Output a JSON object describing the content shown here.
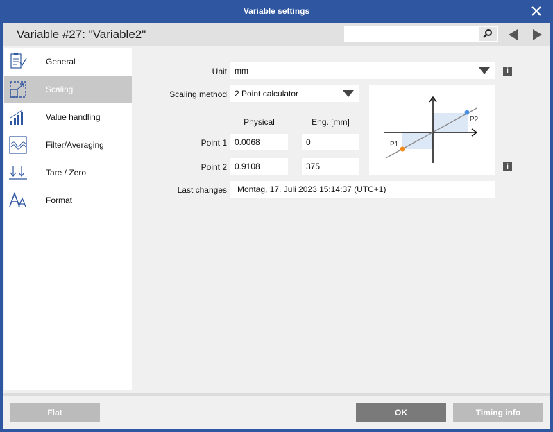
{
  "window": {
    "title": "Variable settings"
  },
  "header": {
    "variable_title": "Variable #27: \"Variable2\"",
    "search_value": ""
  },
  "sidebar": {
    "items": [
      {
        "label": "General",
        "icon": "clipboard-check-icon"
      },
      {
        "label": "Scaling",
        "icon": "scaling-icon",
        "active": true
      },
      {
        "label": "Value handling",
        "icon": "bar-chart-icon"
      },
      {
        "label": "Filter/Averaging",
        "icon": "waveform-icon"
      },
      {
        "label": "Tare / Zero",
        "icon": "tare-arrows-icon"
      },
      {
        "label": "Format",
        "icon": "font-format-icon"
      }
    ]
  },
  "scaling": {
    "unit_label": "Unit",
    "unit_value": "mm",
    "method_label": "Scaling method",
    "method_value": "2 Point calculator",
    "col_physical": "Physical",
    "col_eng": "Eng. [mm]",
    "point1_label": "Point 1",
    "point1_physical": "0.0068",
    "point1_eng": "0",
    "point2_label": "Point 2",
    "point2_physical": "0.9108",
    "point2_eng": "375",
    "last_changes_label": "Last changes",
    "last_changes_value": "Montag, 17. Juli 2023   15:14:37 (UTC+1)",
    "info_label": "i",
    "graph_p1": "P1",
    "graph_p2": "P2"
  },
  "footer": {
    "flat": "Flat",
    "ok": "OK",
    "timing": "Timing info"
  },
  "colors": {
    "titlebar": "#2f56a0",
    "button_gray": "#bbbbbb",
    "button_dark": "#7a7a7a",
    "p1_dot": "#f08a1c",
    "p2_dot": "#4a90e2"
  }
}
